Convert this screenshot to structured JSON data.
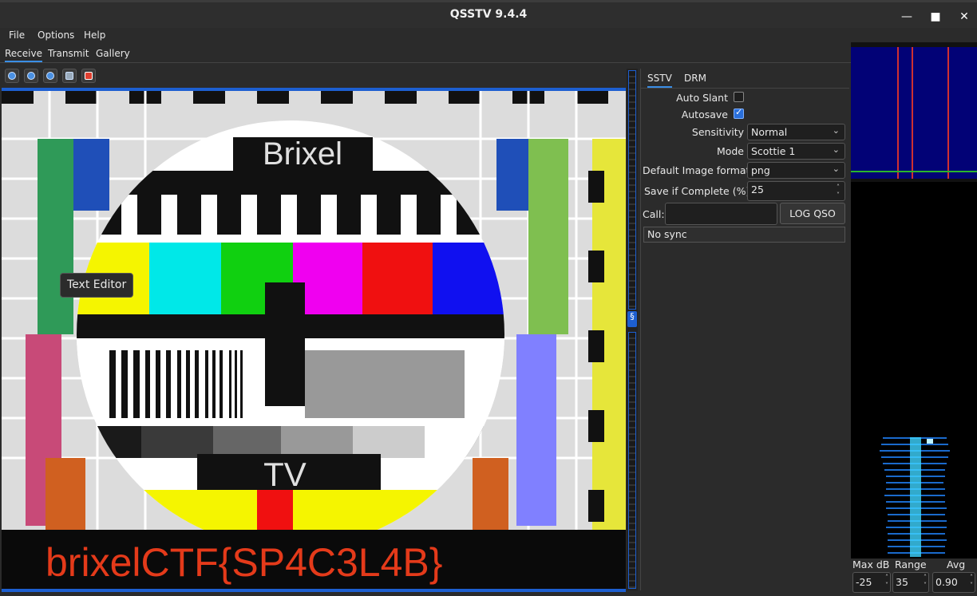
{
  "window": {
    "title": "QSSTV 9.4.4"
  },
  "menu": [
    "File",
    "Options",
    "Help"
  ],
  "main_tabs": [
    "Receive",
    "Transmit",
    "Gallery"
  ],
  "image": {
    "logo_text": "Brixel",
    "tv_text": "TV",
    "caption": "brixelCTF{SP4C3L4B}"
  },
  "tooltip": "Text Editor",
  "sstv_panel": {
    "tabs": [
      "SSTV",
      "DRM"
    ],
    "auto_slant_label": "Auto Slant",
    "auto_slant": false,
    "autosave_label": "Autosave",
    "autosave": true,
    "sensitivity_label": "Sensitivity",
    "sensitivity_value": "Normal",
    "mode_label": "Mode",
    "mode_value": "Scottie 1",
    "image_format_label": "Default Image format",
    "image_format_value": "png",
    "save_complete_label": "Save if Complete (%)",
    "save_complete_value": "25",
    "call_label": "Call:",
    "call_value": "",
    "log_qso_label": "LOG QSO",
    "status": "No sync"
  },
  "spectrum_controls": {
    "max_db_label": "Max dB",
    "max_db_value": "-25",
    "range_label": "Range",
    "range_value": "35",
    "avg_label": "Avg",
    "avg_value": "0.90"
  }
}
